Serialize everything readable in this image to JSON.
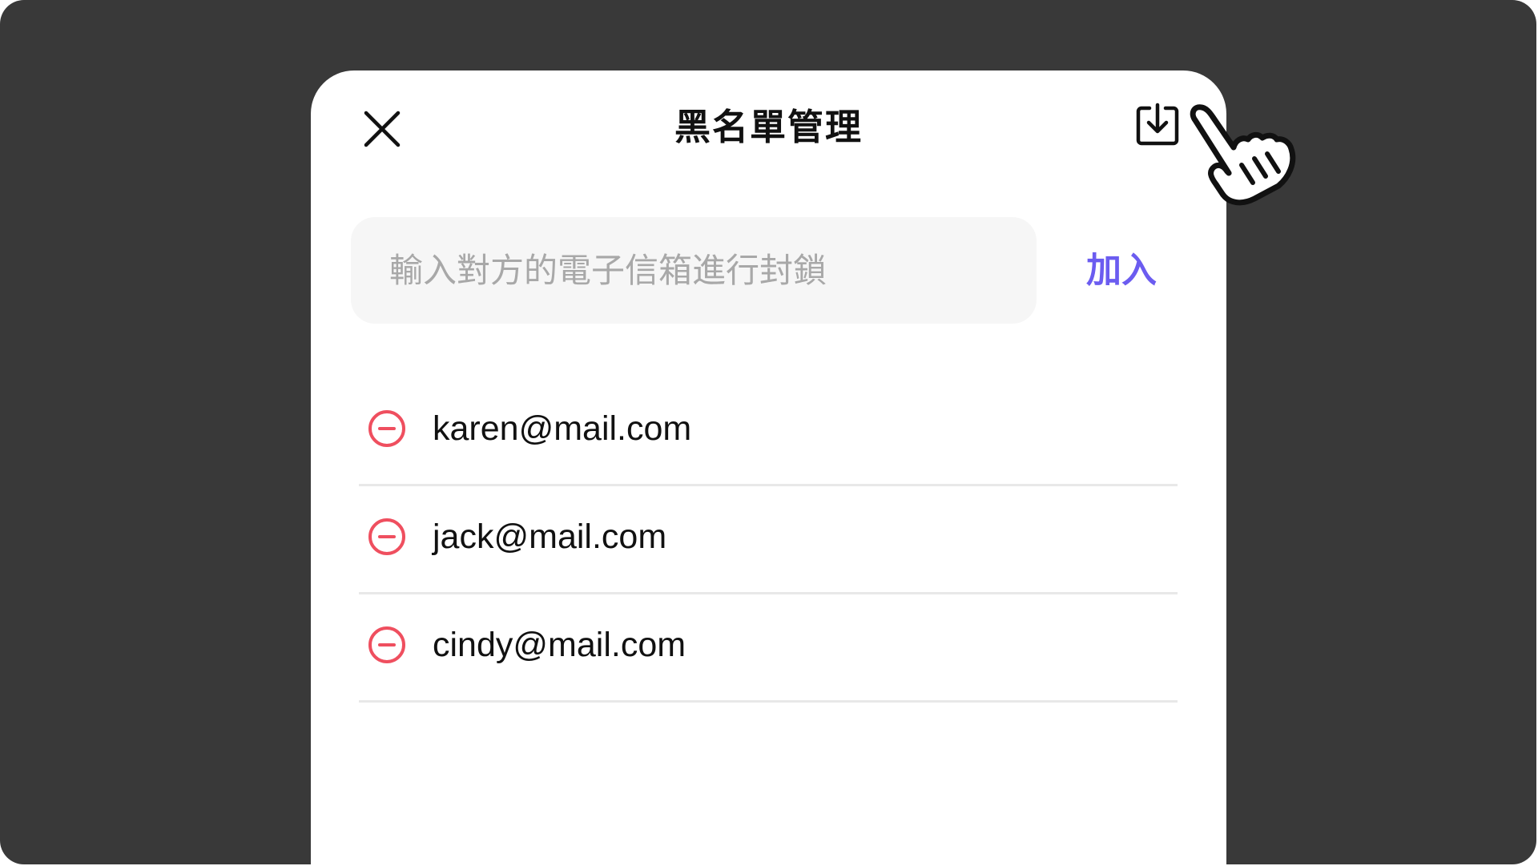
{
  "header": {
    "title": "黑名單管理",
    "close_icon": "close-icon",
    "export_icon": "download-icon"
  },
  "add_form": {
    "placeholder": "輸入對方的電子信箱進行封鎖",
    "value": "",
    "add_label": "加入"
  },
  "blocked_list": [
    {
      "email": "karen@mail.com",
      "icon": "remove-circle-icon"
    },
    {
      "email": "jack@mail.com",
      "icon": "remove-circle-icon"
    },
    {
      "email": "cindy@mail.com",
      "icon": "remove-circle-icon"
    }
  ],
  "colors": {
    "backdrop": "#393939",
    "accent": "#6b5cf0",
    "remove": "#ef4f5f",
    "divider": "#e8e8e8",
    "input_bg": "#f6f6f6"
  },
  "pointer": "hand-pointer-icon"
}
